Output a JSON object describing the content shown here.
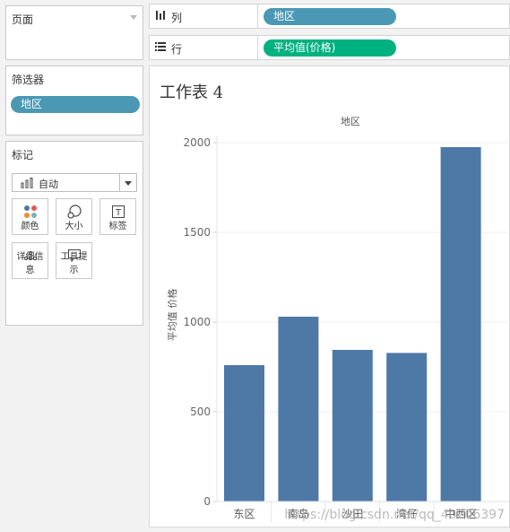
{
  "pages_panel": {
    "title": "页面"
  },
  "filters_panel": {
    "title": "筛选器",
    "pill": "地区"
  },
  "marks_panel": {
    "title": "标记",
    "mark_type": "自动",
    "buttons": [
      {
        "label": "颜色",
        "icon": "color-dots-icon"
      },
      {
        "label": "大小",
        "icon": "size-icon"
      },
      {
        "label": "标签",
        "icon": "text-label-icon"
      },
      {
        "label": "详细信息",
        "icon": "detail-dots-icon"
      },
      {
        "label": "工具提示",
        "icon": "tooltip-icon"
      }
    ]
  },
  "shelves": {
    "columns_label": "列",
    "columns_pill": "地区",
    "rows_label": "行",
    "rows_pill": "平均值(价格)"
  },
  "colors": {
    "dimension_pill": "#4a98b4",
    "measure_pill": "#00b180",
    "bar": "#4e79a7"
  },
  "worksheet": {
    "title": "工作表 4"
  },
  "watermark": "https://blog.csdn.net/qq_40206397",
  "chart_data": {
    "type": "bar",
    "header": "地区",
    "ylabel": "平均值 价格",
    "categories": [
      "东区",
      "南岛",
      "沙田",
      "湾仔",
      "中西区"
    ],
    "values": [
      760,
      1030,
      845,
      828,
      1975
    ],
    "ylim": [
      0,
      2000
    ],
    "yticks": [
      0,
      500,
      1000,
      1500,
      2000
    ],
    "grid": true
  }
}
